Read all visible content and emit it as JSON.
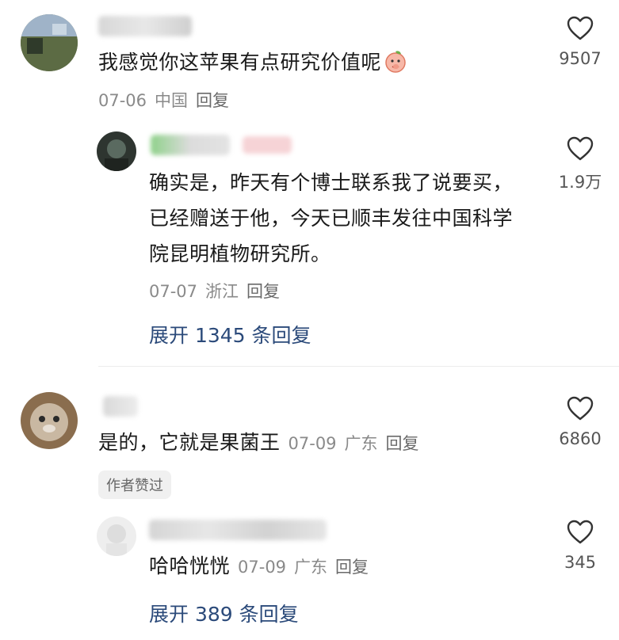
{
  "comments": [
    {
      "text": "我感觉你这苹果有点研究价值呢",
      "date": "07-06",
      "location": "中国",
      "reply_label": "回复",
      "likes": "9507",
      "emoji": "peach-face-icon"
    },
    {
      "text": "确实是，昨天有个博士联系我了说要买，已经赠送于他，今天已顺丰发往中国科学院昆明植物研究所。",
      "date": "07-07",
      "location": "浙江",
      "reply_label": "回复",
      "likes": "1.9万",
      "expand": "展开 1345 条回复"
    },
    {
      "text": "是的，它就是果菌王",
      "date": "07-09",
      "location": "广东",
      "reply_label": "回复",
      "likes": "6860",
      "badge": "作者赞过"
    },
    {
      "text": "哈哈恍恍",
      "date": "07-09",
      "location": "广东",
      "reply_label": "回复",
      "likes": "345",
      "expand": "展开 389 条回复"
    }
  ],
  "colors": {
    "text": "#1a1a1a",
    "meta": "#8a8a8a",
    "link": "#2b4a7a",
    "badge_bg": "#f0f0f0"
  }
}
